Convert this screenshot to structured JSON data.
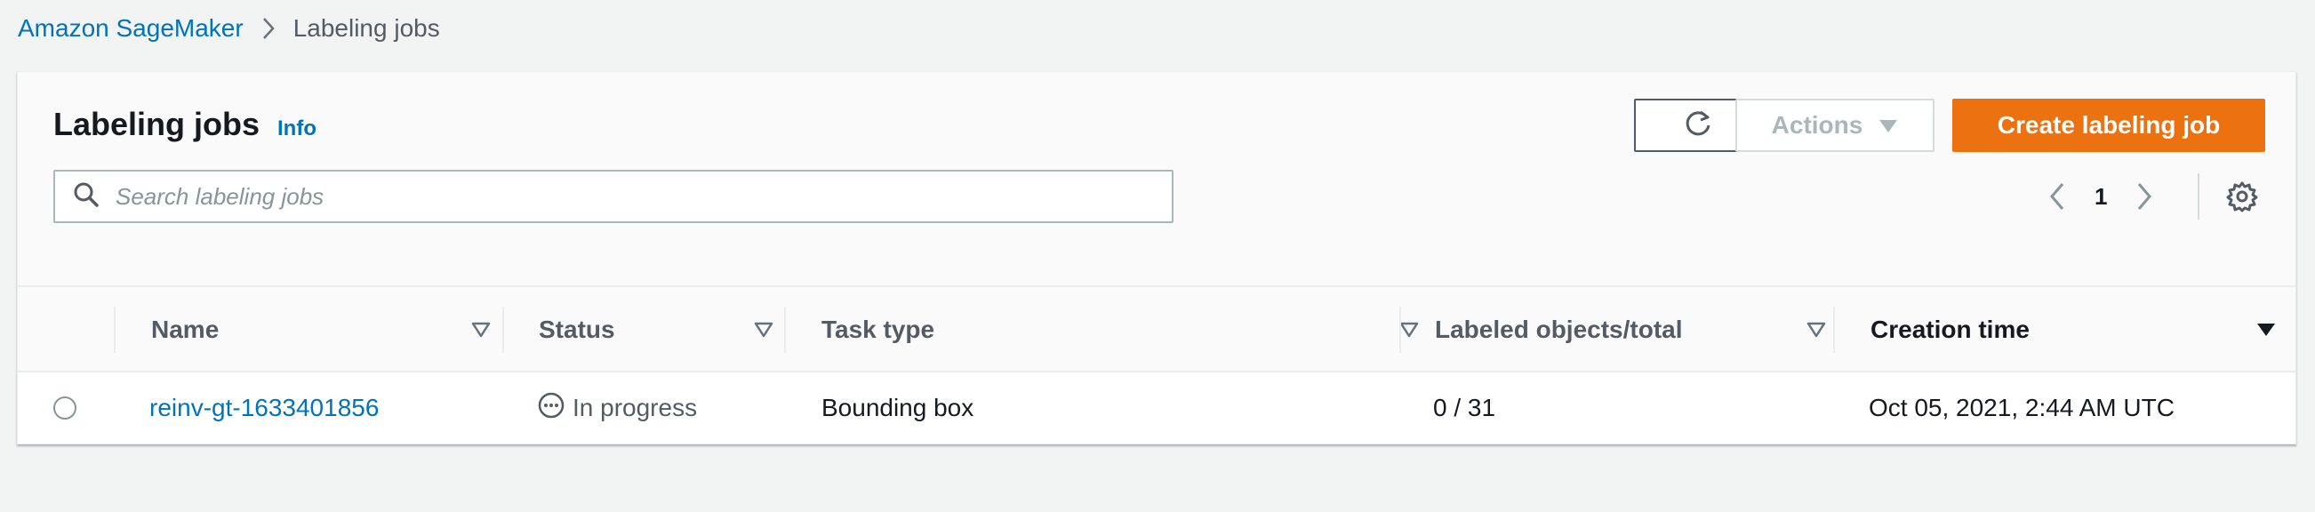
{
  "breadcrumb": {
    "root": "Amazon SageMaker",
    "current": "Labeling jobs"
  },
  "panel": {
    "title": "Labeling jobs",
    "info": "Info",
    "search_placeholder": "Search labeling jobs",
    "actions_label": "Actions",
    "create_label": "Create labeling job",
    "page_current": "1"
  },
  "table": {
    "columns": [
      "Name",
      "Status",
      "Task type",
      "Labeled objects/total",
      "Creation time"
    ],
    "rows": [
      {
        "name": "reinv-gt-1633401856",
        "status": "In progress",
        "task_type": "Bounding box",
        "labeled": "0 / 31",
        "created": "Oct 05, 2021, 2:44 AM UTC"
      }
    ]
  },
  "colors": {
    "link": "#0073bb",
    "primary_button": "#ec7211",
    "background": "#f2f3f3"
  },
  "icons": [
    "chevron-right-icon",
    "search-icon",
    "refresh-icon",
    "caret-down-icon",
    "chevron-left-icon",
    "gear-icon",
    "sort-icon",
    "in-progress-icon"
  ]
}
